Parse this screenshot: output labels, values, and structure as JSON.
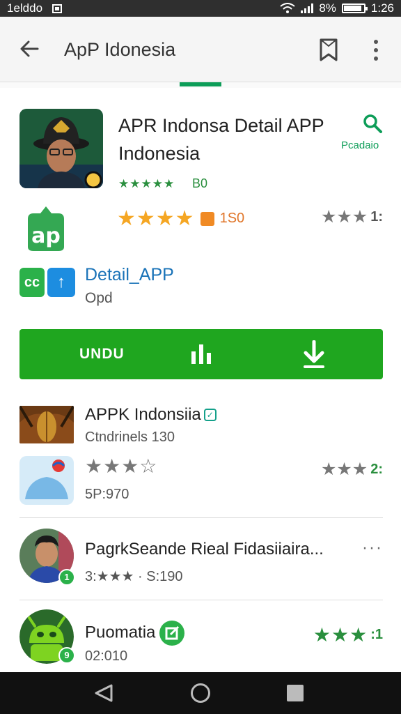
{
  "status_bar": {
    "carrier": "1elddo",
    "wifi_label": "?",
    "battery_pct": "8%",
    "battery_level": 0.9,
    "time": "1:26"
  },
  "app_bar": {
    "title": "ApP Idonesia"
  },
  "hero": {
    "title": "APR Indonsa Detail APP Indonesia",
    "side_label": "Pcadaio",
    "small_stars": "★★★★★",
    "small_count": "B0"
  },
  "rating_row": {
    "stars_orange": "★★★★",
    "count": "1S0",
    "right_stars": "★★★",
    "right_num": "1:"
  },
  "detail": {
    "green_icon_text": "cc",
    "blue_icon_text": "↑",
    "label": "Detail_APP",
    "sub": "Opd"
  },
  "install_button": {
    "label": "UNDU"
  },
  "list": [
    {
      "title": "APPK Indonsiia",
      "sub": "Ctndrinels 130",
      "verified": true
    },
    {
      "stars": "★★★☆",
      "sub": "5P:970",
      "right_stars": "★★★",
      "right_num": "2:"
    },
    {
      "title": "PagrkSeande Rieal Fidasiiaira...",
      "sub": "3:★★★ ·  S:190",
      "badge": "1",
      "overflow": "···"
    },
    {
      "title": "Puomatia",
      "sub": "02:010",
      "badge": "9",
      "right_stars": "★★★",
      "right_num": ":1"
    }
  ],
  "colors": {
    "accent": "#1fa61f",
    "primary_green": "#0d9d58",
    "link_blue": "#1a73b8",
    "star_orange": "#f5a623"
  }
}
